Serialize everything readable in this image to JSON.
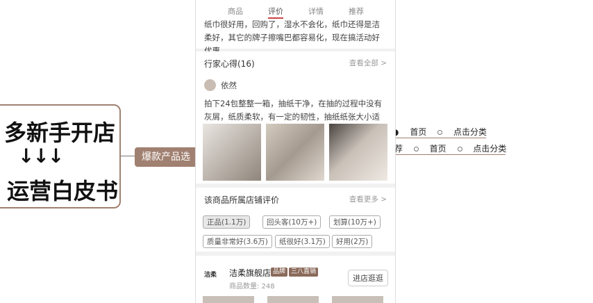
{
  "mindmap": {
    "root": {
      "line1": "多新手开店",
      "arrows": "↓↓↓",
      "line3": "运营白皮书"
    },
    "child_label": "爆款产品选",
    "nav": {
      "row1": [
        "首页",
        "点击分类"
      ],
      "row2_prefix": "推荐",
      "row2": [
        "首页",
        "点击分类"
      ]
    }
  },
  "phone": {
    "tabs": [
      "商品",
      "评价",
      "详情",
      "推荐"
    ],
    "active_tab": "评价",
    "top_review": "纸巾很好用，回购了，湿水不会化，纸巾还得是洁柔好，其它的牌子擦嘴巴都容易化，现在搞活动好优惠",
    "expert_section": {
      "title": "行家心得(16)",
      "more": "查看全部 >",
      "username": "依然",
      "text": "拍下24包整整一箱，抽纸干净，在抽的过程中没有灰屑，纸质柔软，有一定的韧性，抽纸纸张大小适宜，..."
    },
    "shop_reviews": {
      "title": "该商品所属店铺评价",
      "more": "查看更多 >",
      "tags": [
        "正品(1.1万)",
        "回头客(10万+)",
        "划算(10万+)",
        "质量非常好(3.6万)",
        "纸很好(3.1万)",
        "好用(2万)"
      ]
    },
    "store": {
      "logo": "洁柔",
      "name": "洁柔旗舰店",
      "badge1": "品牌",
      "badge2": "三八直销",
      "count": "商品数量: 248",
      "enter": "进店逛逛"
    }
  }
}
